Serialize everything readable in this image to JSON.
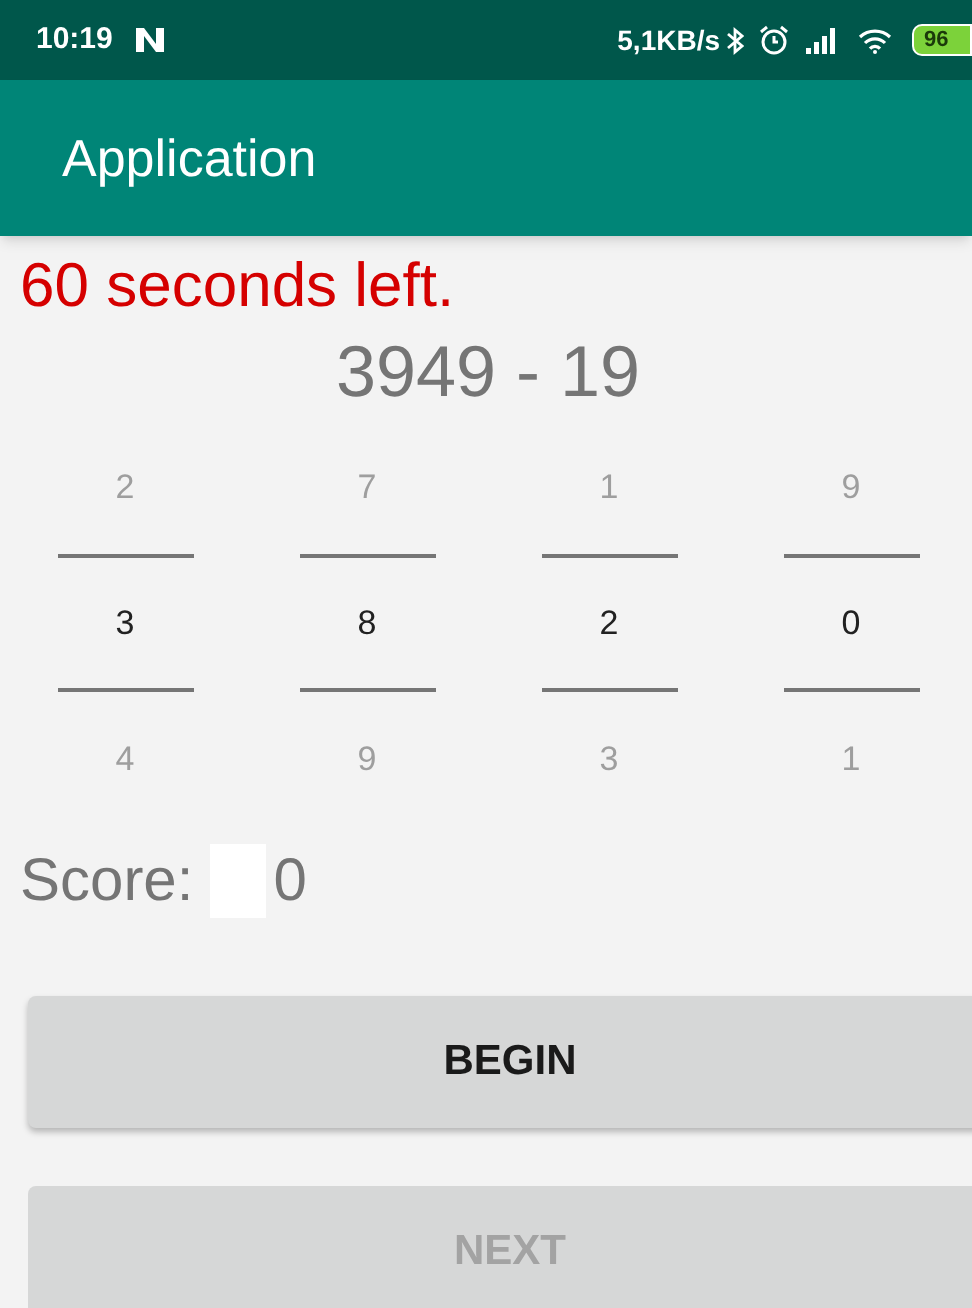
{
  "status_bar": {
    "time": "10:19",
    "speed": "5,1KB/s",
    "battery": "96"
  },
  "app_bar": {
    "title": "Application"
  },
  "timer": "60 seconds left.",
  "problem": "3949 - 19",
  "pickers": [
    {
      "above": "2",
      "value": "3",
      "below": "4"
    },
    {
      "above": "7",
      "value": "8",
      "below": "9"
    },
    {
      "above": "1",
      "value": "2",
      "below": "3"
    },
    {
      "above": "9",
      "value": "0",
      "below": "1"
    }
  ],
  "score": {
    "label": "Score:",
    "value": "0"
  },
  "buttons": [
    {
      "label": "BEGIN",
      "disabled": false
    },
    {
      "label": "NEXT",
      "disabled": true
    }
  ]
}
